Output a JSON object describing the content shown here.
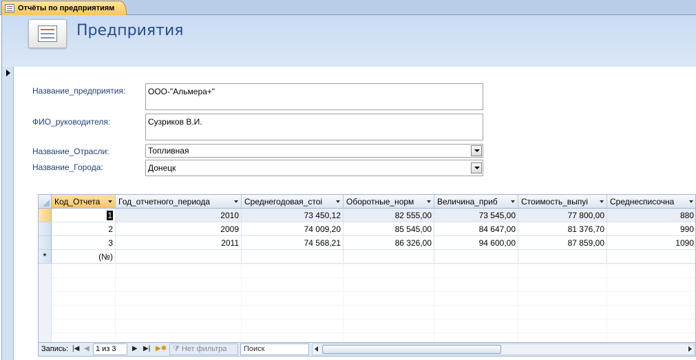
{
  "tab": {
    "title": "Отчёты по предприятиям"
  },
  "header": {
    "title": "Предприятия"
  },
  "form": {
    "company_label": "Название_предприятия:",
    "company_value": "ООО-\"Альмера+\"",
    "director_label": "ФИО_руководителя:",
    "director_value": "Сузриков В.И.",
    "industry_label": "Название_Отрасли:",
    "industry_value": "Топливная",
    "city_label": "Название_Города:",
    "city_value": "Донецк"
  },
  "datasheet": {
    "columns": [
      "Код_Отчета",
      "Год_отчетного_периода",
      "Среднегодовая_стоі",
      "Оборотные_норм",
      "Величина_приб",
      "Стоимость_выпуі",
      "Среднесписочна"
    ],
    "rows": [
      [
        "1",
        "2010",
        "73 450,12",
        "82 555,00",
        "73 545,00",
        "77 800,00",
        "880"
      ],
      [
        "2",
        "2009",
        "74 009,20",
        "85 545,00",
        "84 647,00",
        "81 376,70",
        "990"
      ],
      [
        "3",
        "2011",
        "74 568,21",
        "86 326,00",
        "94 600,00",
        "87 859,00",
        "1090"
      ]
    ],
    "new_row_marker": "*",
    "new_row_placeholder": "(№)"
  },
  "nav": {
    "record_label": "Запись:",
    "record_position": "1 из 3",
    "filter_label": "Нет фильтра",
    "search_label": "Поиск"
  }
}
